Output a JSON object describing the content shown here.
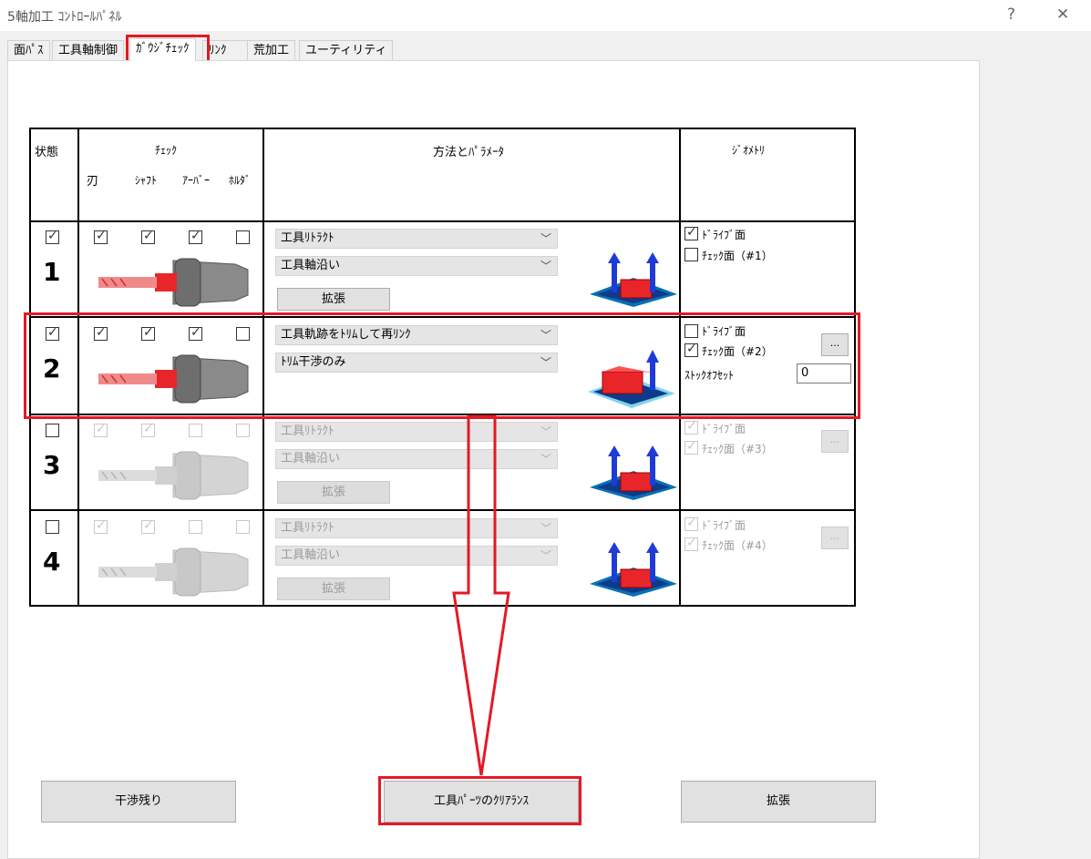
{
  "window": {
    "title": "5軸加工 ｺﾝﾄﾛｰﾙﾊﾟﾈﾙ",
    "help": "?",
    "close": "✕"
  },
  "tabs": [
    {
      "label": "面ﾊﾟｽ"
    },
    {
      "label": "工具軸制御"
    },
    {
      "label": "ｶﾞｳｼﾞﾁｪｯｸ"
    },
    {
      "label": "ﾘﾝｸ"
    },
    {
      "label": "荒加工"
    },
    {
      "label": "ユーティリティ"
    }
  ],
  "table": {
    "headers": {
      "status": "状態",
      "check": "ﾁｪｯｸ",
      "blade": "刃",
      "shaft": "ｼｬﾌﾄ",
      "arbor": "ｱｰﾊﾞｰ",
      "holder": "ﾎﾙﾀﾞ",
      "method": "方法とﾊﾟﾗﾒｰﾀ",
      "geometry": "ｼﾞｵﾒﾄﾘ"
    },
    "rows": [
      {
        "num": "1",
        "status": true,
        "blade": true,
        "shaft": true,
        "arbor": true,
        "holder": false,
        "method1": "工具ﾘﾄﾗｸﾄ",
        "method2": "工具軸沿い",
        "expand": "拡張",
        "drive_face": "ﾄﾞﾗｲﾌﾞ面",
        "check_face": "ﾁｪｯｸ面（#1）"
      },
      {
        "num": "2",
        "status": true,
        "blade": true,
        "shaft": true,
        "arbor": true,
        "holder": false,
        "method1": "工具軌跡をﾄﾘﾑして再ﾘﾝｸ",
        "method2": "ﾄﾘﾑ干渉のみ",
        "drive_face": "ﾄﾞﾗｲﾌﾞ面",
        "check_face": "ﾁｪｯｸ面（#2）",
        "stock_offset_label": "ｽﾄｯｸｵﾌｾｯﾄ",
        "stock_offset_value": "0",
        "ellipsis": "..."
      },
      {
        "num": "3",
        "status": false,
        "blade": true,
        "shaft": true,
        "arbor": false,
        "holder": false,
        "method1": "工具ﾘﾄﾗｸﾄ",
        "method2": "工具軸沿い",
        "expand": "拡張",
        "drive_face": "ﾄﾞﾗｲﾌﾞ面",
        "check_face": "ﾁｪｯｸ面（#3）",
        "ellipsis": "..."
      },
      {
        "num": "4",
        "status": false,
        "blade": true,
        "shaft": true,
        "arbor": false,
        "holder": false,
        "method1": "工具ﾘﾄﾗｸﾄ",
        "method2": "工具軸沿い",
        "expand": "拡張",
        "drive_face": "ﾄﾞﾗｲﾌﾞ面",
        "check_face": "ﾁｪｯｸ面（#4）",
        "ellipsis": "..."
      }
    ]
  },
  "bottom_buttons": {
    "remaining": "干渉残り",
    "clearance": "工具ﾊﾟｰﾂのｸﾘｱﾗﾝｽ",
    "expand": "拡張"
  },
  "colors": {
    "highlight": "#e21a23",
    "tool_red": "#e8262a",
    "gauge_blue": "#1f3bd6"
  }
}
